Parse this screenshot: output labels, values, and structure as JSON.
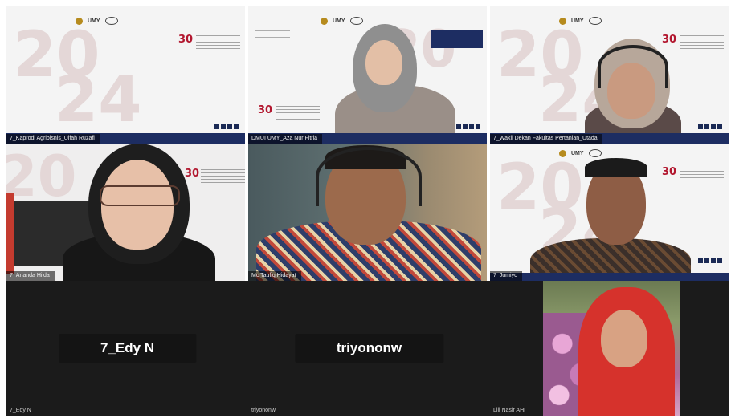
{
  "participants": [
    {
      "name": "7_Kaprodi Agribisnis_Ulfah Ruzafi",
      "video": true
    },
    {
      "name": "DMUI UMY_Aza Nur Fitria",
      "video": true
    },
    {
      "name": "7_Wakil Dekan Fakultas Pertanian_Utada",
      "video": true
    },
    {
      "name": "7_Ananda Hilda",
      "video": true
    },
    {
      "name": "Mc Taufiq Hidayat",
      "video": true
    },
    {
      "name": "7_Jumiyo",
      "video": true
    },
    {
      "name": "7_Edy N",
      "video": false,
      "display_name": "7_Edy N"
    },
    {
      "name": "triyononw",
      "video": false,
      "display_name": "triyononw"
    },
    {
      "name": "Lili Nasir AHI",
      "video": true
    }
  ],
  "slide": {
    "year_top": "20",
    "year_bottom": "24",
    "badge": "30",
    "institution": "UMY"
  },
  "colors": {
    "slide_navy": "#1d2d62",
    "badge_red": "#b2162e",
    "logo_gold": "#b68b1e",
    "empty_tile": "#1b1b1b"
  }
}
